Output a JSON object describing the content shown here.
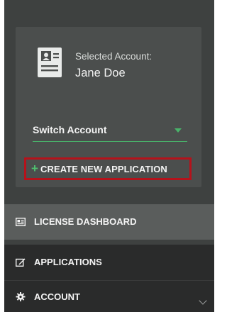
{
  "account": {
    "selected_label": "Selected Account:",
    "selected_name": "Jane Doe",
    "switch_label": "Switch Account"
  },
  "actions": {
    "create_label": "CREATE NEW APPLICATION",
    "create_plus": "+"
  },
  "nav": {
    "items": [
      {
        "label": "LICENSE DASHBOARD",
        "icon": "id-card-icon",
        "active": true
      },
      {
        "label": "APPLICATIONS",
        "icon": "edit-icon",
        "active": false
      },
      {
        "label": "ACCOUNT",
        "icon": "gear-icon",
        "active": false
      }
    ]
  },
  "colors": {
    "accent_green": "#49b36a",
    "highlight_red": "#b5121b",
    "sidebar_bg": "#3e4140"
  }
}
